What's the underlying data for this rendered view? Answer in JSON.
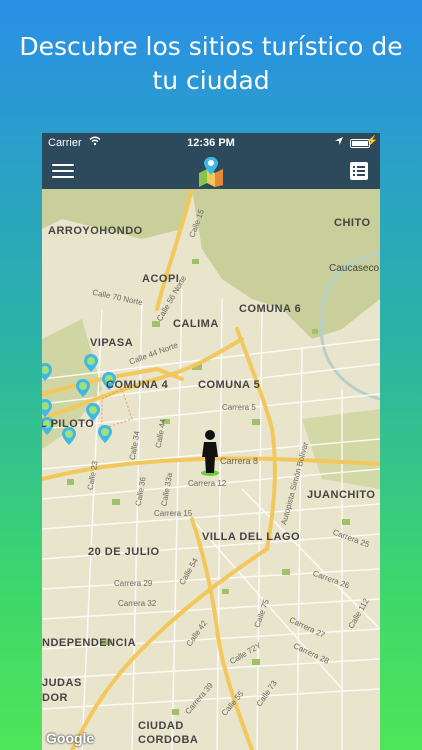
{
  "headline": "Descubre los sitios turístico de tu ciudad",
  "statusbar": {
    "carrier": "Carrier",
    "time": "12:36 PM"
  },
  "navbar": {
    "menu_icon": "hamburger-menu-icon",
    "logo_icon": "map-pin-logo-icon",
    "list_icon": "list-icon"
  },
  "map": {
    "attribution": "Google",
    "neighborhoods": {
      "arroyohondo": "ARROYOHONDO",
      "acopi": "ACOPI",
      "comuna6": "COMUNA 6",
      "calima": "CALIMA",
      "vipasa": "VIPASA",
      "comuna4": "COMUNA 4",
      "comuna5": "COMUNA 5",
      "pilo": "L PILOTO",
      "juanchito": "JUANCHITO",
      "villa_del_lago": "VILLA DEL LAGO",
      "veinte_julio": "20 DE JULIO",
      "independencia": "NDEPENDENCIA",
      "judas": "JUDAS",
      "dor": "DOR",
      "ciudad_cordoba_1": "CIUDAD",
      "ciudad_cordoba_2": "CORDOBA",
      "caucaseco": "Caucaseco",
      "chito": "CHITO"
    },
    "streets": {
      "calle15": "Calle 15",
      "calle70": "Calle 70 Norte",
      "calle56": "Calle 56 Norte",
      "calle44n": "Calle 44 Norte",
      "carrera5": "Carrera 5",
      "carrera8": "Carrera 8",
      "carrera12": "Carrera 12",
      "calle44": "Calle 44",
      "calle34": "Calle 34",
      "calle33a": "Calle 33a",
      "calle36": "Calle 36",
      "calle23": "Calle 23",
      "carrera15": "Carrera 15",
      "autopista": "Autopista Simón Bolívar",
      "carrera25": "Carrera 25",
      "carrera26": "Carrera 26",
      "carrera29": "Carrera 29",
      "carrera32": "Carrera 32",
      "calle54": "Calle 54",
      "calle42": "Calle 42",
      "calle72y": "Calle 72Y",
      "carrera27": "Carrera 27",
      "calle112": "Calle 112",
      "carrera39": "Carrera 39",
      "calle55": "Calle 55",
      "calle73": "Calle 73",
      "carrera28": "Carrera 28",
      "calle75": "Calle 75"
    }
  },
  "colors": {
    "navbar": "#2d4a5c",
    "map_bg": "#e9e4cc",
    "major_road": "#f2c85c",
    "park": "#9fc16a",
    "water": "#b8cfc9",
    "pin": "#3fb8e6"
  }
}
